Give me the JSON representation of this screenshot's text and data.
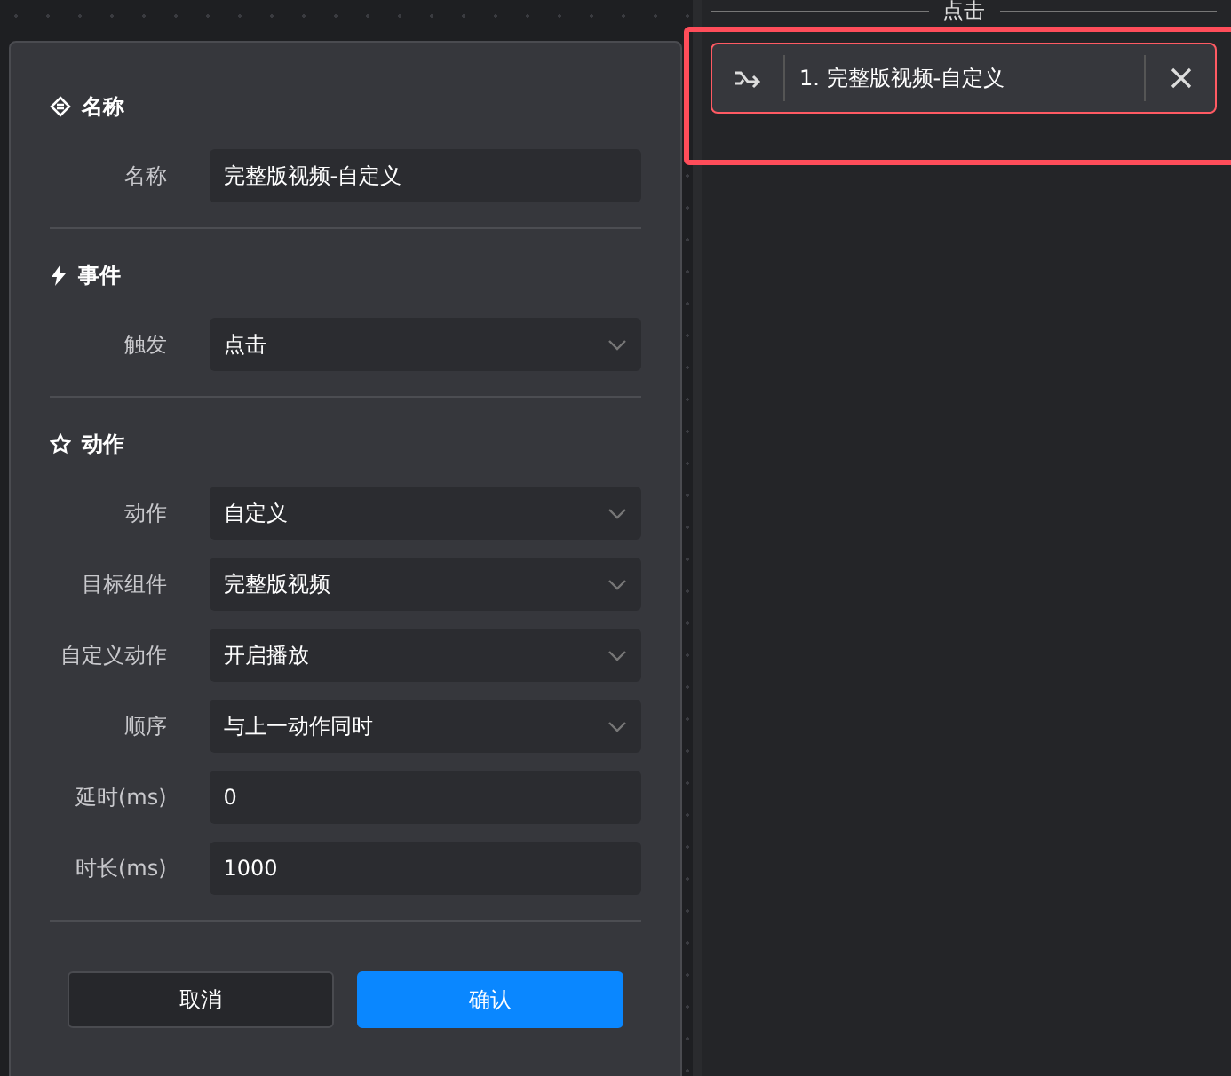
{
  "dialog": {
    "sections": [
      {
        "title": "名称",
        "fields": [
          {
            "label": "名称",
            "kind": "text",
            "value": "完整版视频-自定义"
          }
        ]
      },
      {
        "title": "事件",
        "fields": [
          {
            "label": "触发",
            "kind": "select",
            "value": "点击"
          }
        ]
      },
      {
        "title": "动作",
        "fields": [
          {
            "label": "动作",
            "kind": "select",
            "value": "自定义"
          },
          {
            "label": "目标组件",
            "kind": "select",
            "value": "完整版视频"
          },
          {
            "label": "自定义动作",
            "kind": "select",
            "value": "开启播放"
          },
          {
            "label": "顺序",
            "kind": "select",
            "value": "与上一动作同时"
          },
          {
            "label": "延时(ms)",
            "kind": "text",
            "value": "0"
          },
          {
            "label": "时长(ms)",
            "kind": "text",
            "value": "1000"
          }
        ]
      }
    ],
    "buttons": [
      {
        "label": "取消",
        "kind": "secondary"
      },
      {
        "label": "确认",
        "kind": "primary"
      }
    ]
  },
  "event_panel": {
    "heading": "点击",
    "items": [
      {
        "label": "1. 完整版视频-自定义",
        "selected": true
      }
    ]
  }
}
